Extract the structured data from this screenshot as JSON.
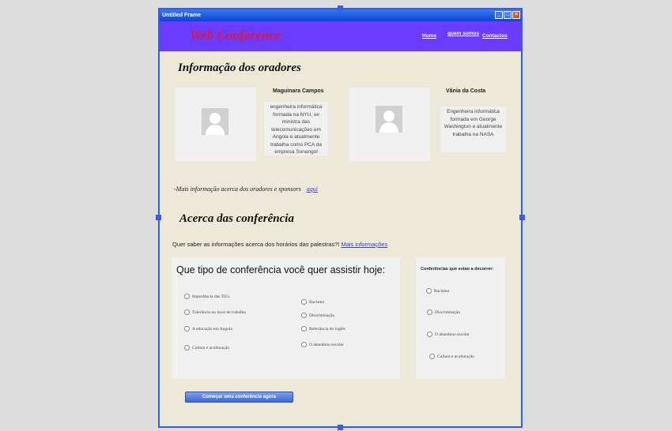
{
  "window": {
    "title": "Untitled Frame"
  },
  "header": {
    "logo": "Web Conference",
    "nav": [
      "Home",
      "quem somos",
      "Contactos"
    ]
  },
  "speakers": {
    "heading": "Informação dos oradores",
    "items": [
      {
        "name": "Maguinara Campos",
        "bio": "engenheira informática formada na NYU, ex ministra das telecomunicações em Angola e atualmente trabalha como PCA da empresa Sonangol"
      },
      {
        "name": "Vânia da Costa",
        "bio": "Engenheira informática formada em George Washington e atualmente trabalha na NASA"
      }
    ],
    "more_text": "-Mais informação acerca dos oradores e sponsors",
    "more_link": "aqui"
  },
  "about": {
    "heading": "Acerca das conferência",
    "question": "Quer saber as informações acerca dos horários das palestras?!",
    "question_link": "Mais informações"
  },
  "choose_panel": {
    "title": "Que tipo de conferência você quer assistir hoje:",
    "left_options": [
      "Importância das TICs",
      "Tolerância no local de trabalho",
      "A educação em Angola",
      "Cultura e aculturação"
    ],
    "right_options": [
      "Racismo",
      "Discriminação",
      "Relevância do inglês",
      "O abandono escolar"
    ]
  },
  "ongoing_panel": {
    "title": "Conferências que estao a decorrer:",
    "options": [
      "Racismo",
      "Discriminação",
      "O abandono escolar",
      "Cultura e aculturação"
    ]
  },
  "start_button": "Começar uma conferência agora"
}
